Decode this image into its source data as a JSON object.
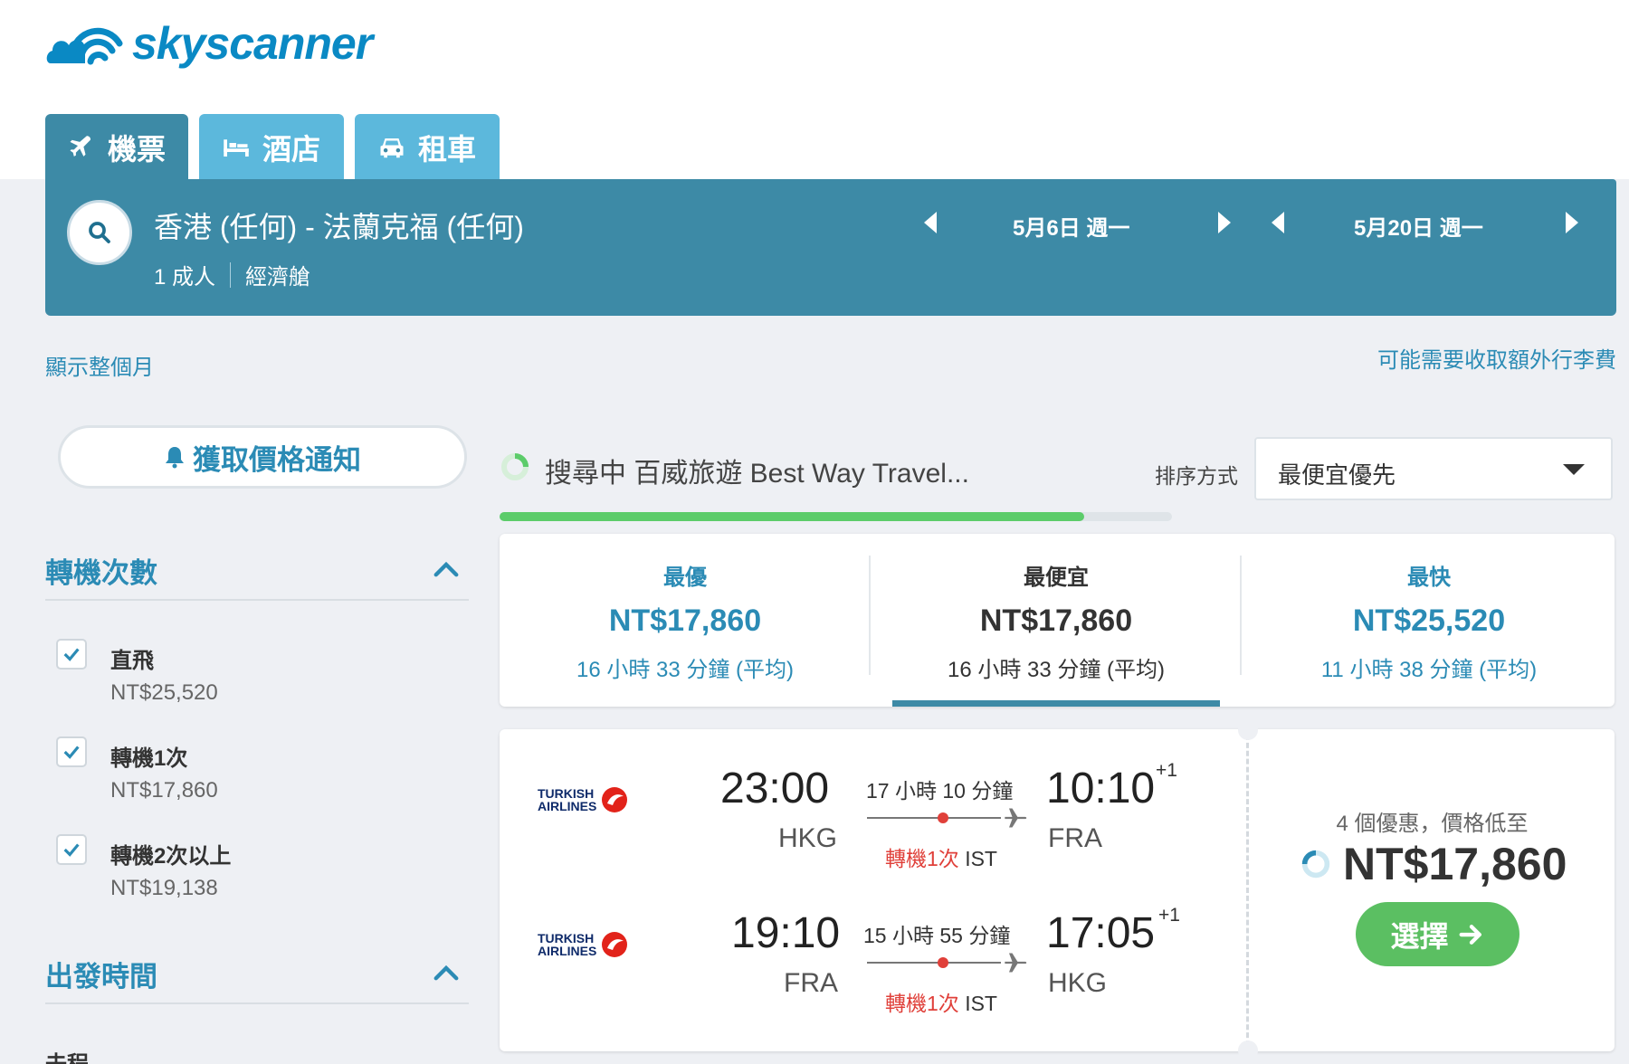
{
  "brand": {
    "name": "skyscanner",
    "color": "#0a89c4"
  },
  "tabs": [
    {
      "label": "機票",
      "icon": "plane-icon",
      "active": true
    },
    {
      "label": "酒店",
      "icon": "bed-icon",
      "active": false
    },
    {
      "label": "租車",
      "icon": "car-icon",
      "active": false
    }
  ],
  "search": {
    "route": "香港 (任何) - 法蘭克福 (任何)",
    "passengers": "1 成人",
    "cabin": "經濟艙",
    "depart_date": "5月6日 週一",
    "return_date": "5月20日 週一"
  },
  "links": {
    "show_month": "顯示整個月",
    "baggage_fee": "可能需要收取額外行李費"
  },
  "sidebar": {
    "price_alert": "獲取價格通知",
    "stops_title": "轉機次數",
    "stops": [
      {
        "label": "直飛",
        "price": "NT$25,520",
        "checked": true
      },
      {
        "label": "轉機1次",
        "price": "NT$17,860",
        "checked": true
      },
      {
        "label": "轉機2次以上",
        "price": "NT$19,138",
        "checked": true
      }
    ],
    "depart_time_title": "出發時間",
    "outbound_label": "去程"
  },
  "results": {
    "searching_text": "搜尋中 百威旅遊 Best Way Travel...",
    "progress": 0.87,
    "sort_label": "排序方式",
    "sort_value": "最便宜優先"
  },
  "summary": [
    {
      "title": "最優",
      "price": "NT$17,860",
      "duration": "16 小時 33 分鐘 (平均)",
      "selected": false
    },
    {
      "title": "最便宜",
      "price": "NT$17,860",
      "duration": "16 小時 33 分鐘 (平均)",
      "selected": true
    },
    {
      "title": "最快",
      "price": "NT$25,520",
      "duration": "11 小時 38 分鐘 (平均)",
      "selected": false
    }
  ],
  "flight": {
    "airline": "Turkish Airlines",
    "airline_line1": "TURKISH",
    "airline_line2": "AIRLINES",
    "legs": [
      {
        "depart_time": "23:00",
        "depart_code": "HKG",
        "duration": "17 小時 10 分鐘",
        "stops": "轉機1次",
        "via": "IST",
        "arrive_time": "10:10",
        "arrive_code": "FRA",
        "day_offset": "+1"
      },
      {
        "depart_time": "19:10",
        "depart_code": "FRA",
        "duration": "15 小時 55 分鐘",
        "stops": "轉機1次",
        "via": "IST",
        "arrive_time": "17:05",
        "arrive_code": "HKG",
        "day_offset": "+1"
      }
    ],
    "deals_text": "4 個優惠，價格低至",
    "price": "NT$17,860",
    "select_label": "選擇"
  },
  "colors": {
    "accent": "#3d8aa6",
    "tab_inactive": "#5cb8dc",
    "link": "#2b8bb5",
    "green": "#5bbf62",
    "stop_red": "#e0403a"
  }
}
